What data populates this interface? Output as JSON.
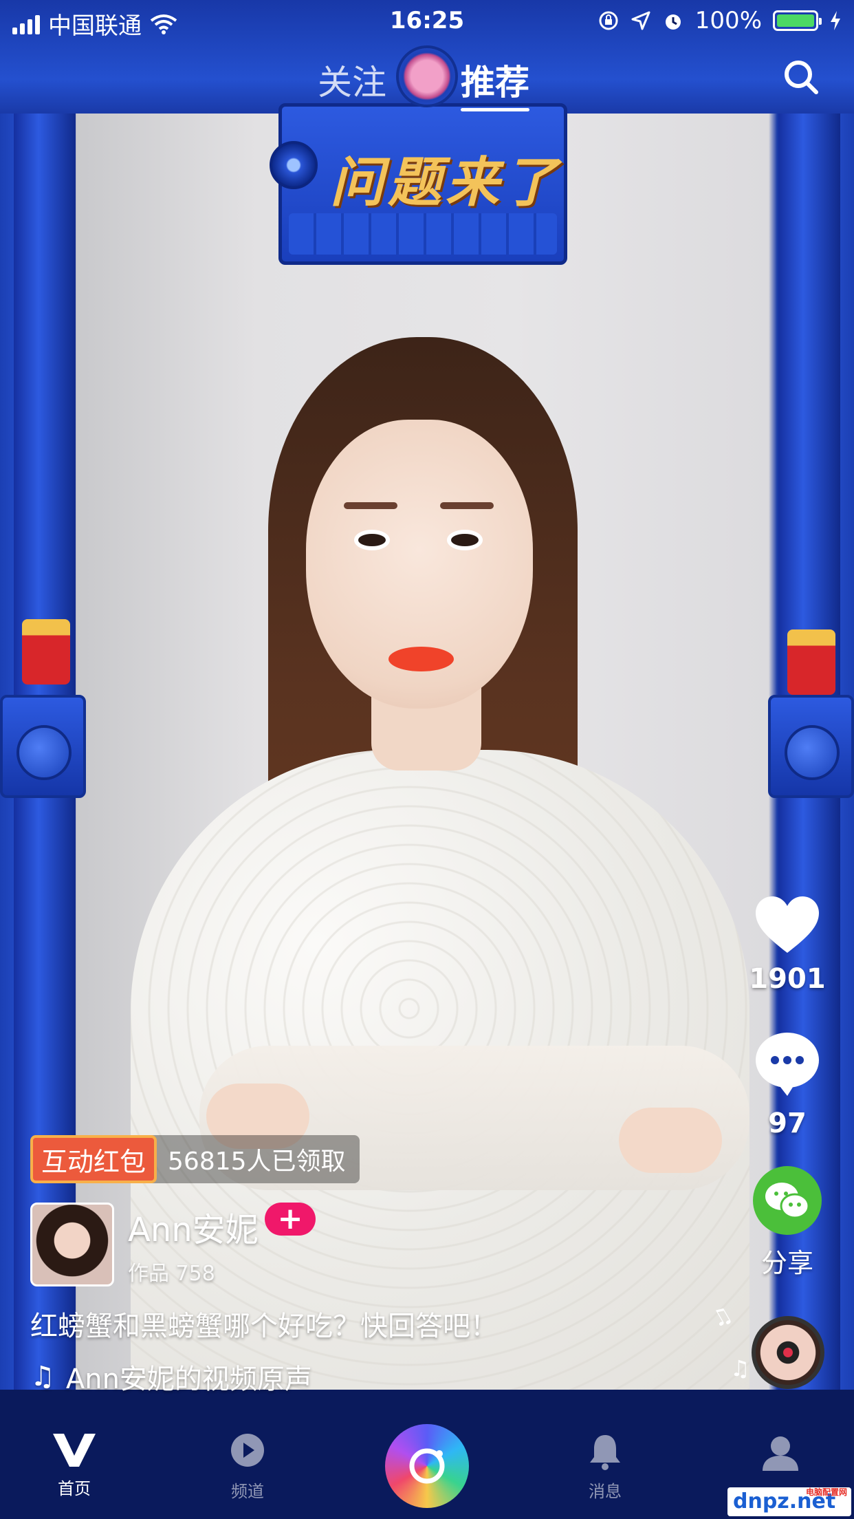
{
  "status_bar": {
    "carrier": "中国联通",
    "time": "16:25",
    "battery_percent": "100%",
    "battery_color": "#4cd964"
  },
  "top_tabs": [
    {
      "label": "关注",
      "active": false
    },
    {
      "label": "推荐",
      "active": true
    }
  ],
  "video": {
    "sign_text": "问题来了",
    "likes": "1901",
    "comments": "97",
    "share_label": "分享"
  },
  "red_packet": {
    "tag": "互动红包",
    "claimed_text": "56815人已领取",
    "tag_color": "#ec5a3c"
  },
  "author": {
    "name": "Ann安妮",
    "follow_symbol": "+",
    "works_label": "作品 758"
  },
  "caption": "红螃蟹和黑螃蟹哪个好吃？快回答吧！",
  "music": {
    "title": "Ann安妮的视频原声",
    "icon": "music-note-icon"
  },
  "bottom_nav": [
    {
      "label": "首页",
      "icon": "home-v-icon",
      "active": true
    },
    {
      "label": "频道",
      "icon": "play-channel-icon",
      "active": false
    },
    {
      "label": "",
      "icon": "camera-icon",
      "active": false
    },
    {
      "label": "消息",
      "icon": "bell-icon",
      "active": false
    },
    {
      "label": "",
      "icon": "profile-icon",
      "active": false
    }
  ],
  "watermark": {
    "text": "dnpz.net",
    "sub": "电脑配置网"
  },
  "colors": {
    "accent_pink": "#f0186a",
    "share_green": "#4bbf3a",
    "frame_blue": "#2450cf"
  }
}
